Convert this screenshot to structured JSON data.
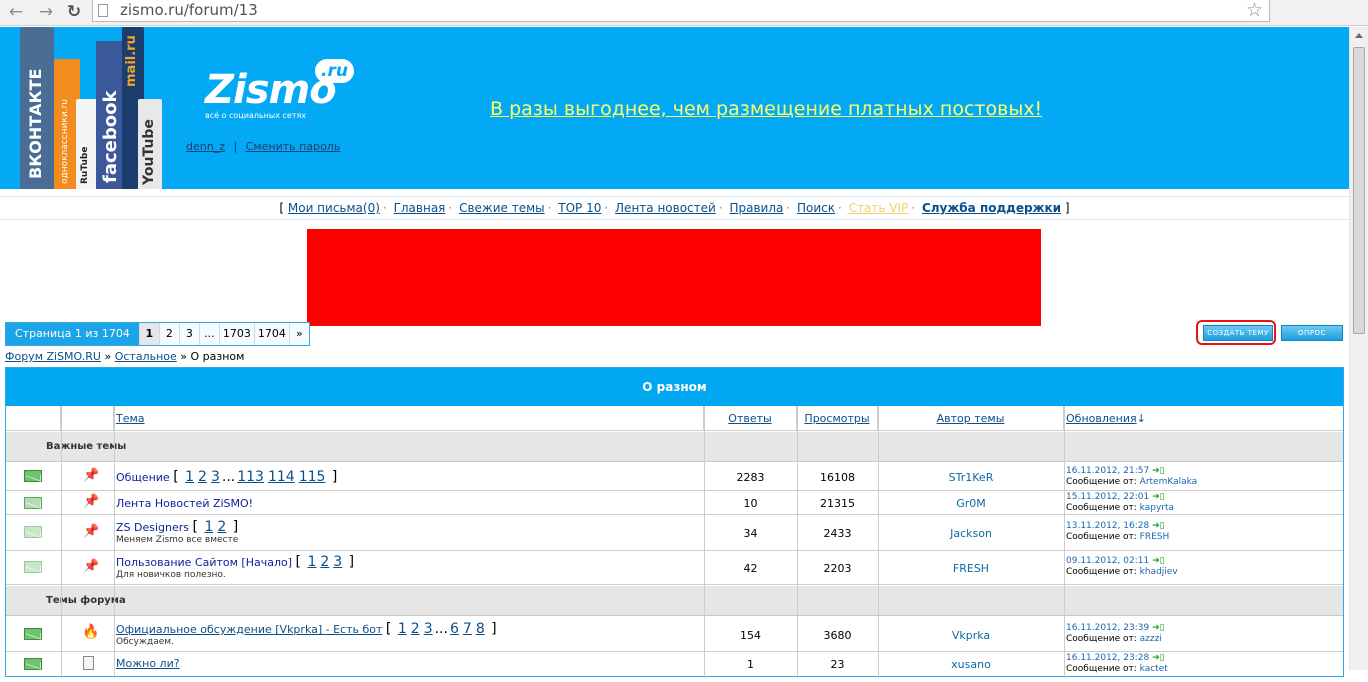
{
  "browser": {
    "url": "zismo.ru/forum/13"
  },
  "header": {
    "logo": "Zismo",
    "logo_badge": ".ru",
    "tagline": "всё о социальных сетях",
    "banner_strips": [
      "ВКОНТАКТЕ",
      "одноклассники.ru",
      "facebook",
      "RuTube",
      "mail.ru",
      "YouTube"
    ],
    "username": "denn_z",
    "change_password": "Сменить пароль",
    "promo": "В разы выгоднее, чем размещение платных постовых!"
  },
  "topnav": {
    "items": [
      "Мои письма(0)",
      "Главная",
      "Свежие темы",
      "TOP 10",
      "Лента новостей",
      "Правила",
      "Поиск",
      "Стать VIP",
      "Служба поддержки"
    ]
  },
  "pager": {
    "label": "Страница 1 из 1704",
    "pages": [
      "1",
      "2",
      "3",
      "...",
      "1703",
      "1704",
      "»"
    ]
  },
  "buttons": {
    "new_topic": "СОЗДАТЬ ТЕМУ",
    "poll": "ОПРОС"
  },
  "breadcrumb": {
    "root": "Форум ZiSMO.RU",
    "sep": "»",
    "parent": "Остальное",
    "current": "О разном"
  },
  "forum": {
    "title": "О разном",
    "columns": {
      "topic": "Тема",
      "replies": "Ответы",
      "views": "Просмотры",
      "author": "Автор темы",
      "updates": "Обновления"
    },
    "sections": {
      "important": "Важные темы",
      "topics": "Темы форума"
    },
    "last_post_prefix": "Сообщение от:",
    "rows": [
      {
        "title": "Общение",
        "pages": [
          "1",
          "2",
          "3",
          "...",
          "113",
          "114",
          "115"
        ],
        "desc": "",
        "replies": "2283",
        "views": "16108",
        "author": "STr1KeR",
        "date": "16.11.2012, 21:57",
        "last_by": "ArtemKalaka"
      },
      {
        "title": "Лента Новостей ZiSMO!",
        "pages": [],
        "desc": "",
        "replies": "10",
        "views": "21315",
        "author": "Gr0M",
        "date": "15.11.2012, 22:01",
        "last_by": "kapyrta"
      },
      {
        "title": "ZS Designers",
        "pages": [
          "1",
          "2"
        ],
        "desc": "Меняем Zismo все вместе",
        "replies": "34",
        "views": "2433",
        "author": "Jackson",
        "date": "13.11.2012, 16:28",
        "last_by": "FRESH"
      },
      {
        "title": "Пользование Сайтом [Начало]",
        "pages": [
          "1",
          "2",
          "3"
        ],
        "desc": "Для новичков полезно.",
        "replies": "42",
        "views": "2203",
        "author": "FRESH",
        "date": "09.11.2012, 02:11",
        "last_by": "khadjiev"
      },
      {
        "title": "Официальное обсуждение [Vkprka] - Есть бот",
        "pages": [
          "1",
          "2",
          "3",
          "...",
          "6",
          "7",
          "8"
        ],
        "desc": "Обсуждаем.",
        "replies": "154",
        "views": "3680",
        "author": "Vkprka",
        "date": "16.11.2012, 23:39",
        "last_by": "azzzi"
      },
      {
        "title": "Можно ли?",
        "pages": [],
        "desc": "",
        "replies": "1",
        "views": "23",
        "author": "xusano",
        "date": "16.11.2012, 23:28",
        "last_by": "kactet"
      }
    ]
  },
  "colors": {
    "brand_blue": "#03a9f4",
    "ad_red": "#ff0000",
    "promo_yellow": "#ffff66",
    "highlight_ring": "#e81414"
  }
}
